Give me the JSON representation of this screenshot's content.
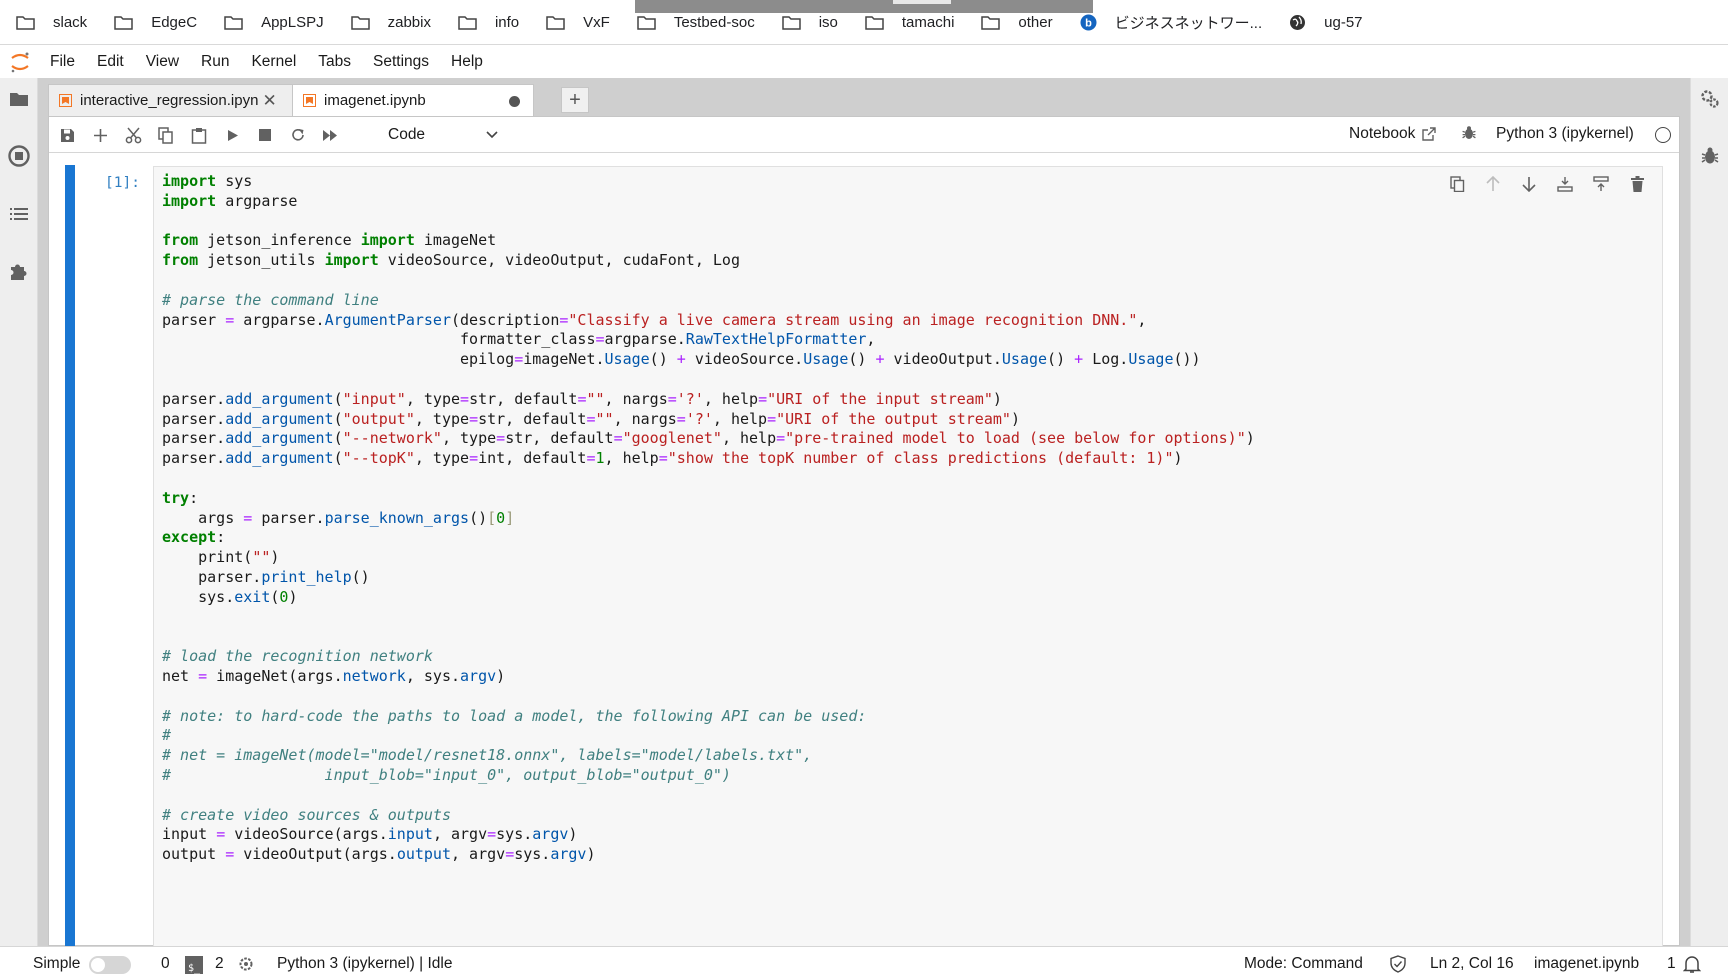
{
  "bookmarks": [
    {
      "label": "slack",
      "icon": "folder-icon"
    },
    {
      "label": "EdgeC",
      "icon": "folder-icon"
    },
    {
      "label": "AppLSPJ",
      "icon": "folder-icon"
    },
    {
      "label": "zabbix",
      "icon": "folder-icon"
    },
    {
      "label": "info",
      "icon": "folder-icon"
    },
    {
      "label": "VxF",
      "icon": "folder-icon"
    },
    {
      "label": "Testbed-soc",
      "icon": "folder-icon"
    },
    {
      "label": "iso",
      "icon": "folder-icon"
    },
    {
      "label": "tamachi",
      "icon": "folder-icon"
    },
    {
      "label": "other",
      "icon": "folder-icon"
    },
    {
      "label": "ビジネスネットワー...",
      "icon": "site-b-icon"
    },
    {
      "label": "ug-57",
      "icon": "globe-icon"
    }
  ],
  "menu": [
    "File",
    "Edit",
    "View",
    "Run",
    "Kernel",
    "Tabs",
    "Settings",
    "Help"
  ],
  "tabs": [
    {
      "label": "interactive_regression.ipyn",
      "active": false,
      "status": "close"
    },
    {
      "label": "imagenet.ipynb",
      "active": true,
      "status": "dirty"
    }
  ],
  "toolbar": {
    "cell_type": "Code",
    "notebook_label": "Notebook",
    "kernel_name": "Python 3 (ipykernel)"
  },
  "cell": {
    "prompt": "[1]:"
  },
  "statusbar": {
    "mode_simple": "Simple",
    "terminals": "0",
    "kernels": "2",
    "kernel_status": "Python 3 (ipykernel) | Idle",
    "mode": "Mode: Command",
    "cursor": "Ln 2, Col 16",
    "filename": "imagenet.ipynb",
    "notifications": "1"
  },
  "colors": {
    "accent": "#1976d2",
    "keyword": "#008000",
    "string": "#ba2121",
    "comment": "#408080"
  }
}
